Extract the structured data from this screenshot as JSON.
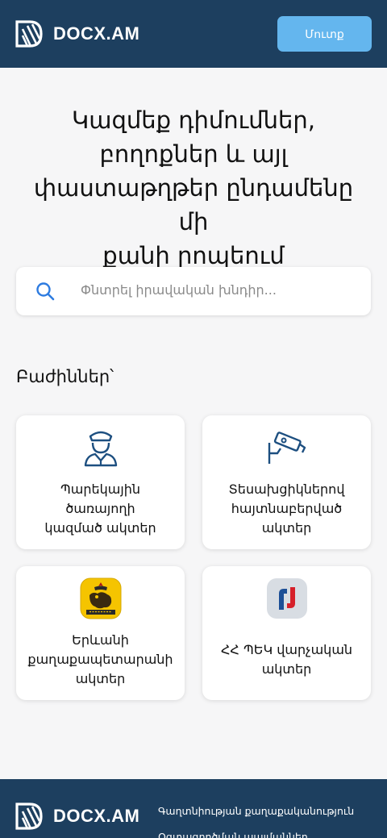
{
  "header": {
    "logo_text": "DOCX.AM",
    "login_label": "Մուտք"
  },
  "hero": {
    "title_lines": [
      "Կազմեք դիմումներ,",
      "բողոքներ և այլ",
      "փաստաթղթեր ընդամենը մի",
      "քանի րոպեում"
    ]
  },
  "search": {
    "placeholder": "Փնտրել իրավական խնդիր..."
  },
  "sections": {
    "title": "Բաժիններ՝",
    "cards": [
      {
        "icon": "officer-icon",
        "lines": [
          "Պարեկային",
          "ծառայողի",
          "կազմած ակտեր"
        ]
      },
      {
        "icon": "camera-icon",
        "lines": [
          "Տեսախցիկներով",
          "հայտնաբերված",
          "ակտեր"
        ]
      },
      {
        "icon": "yerevan-emblem-icon",
        "lines": [
          "Երևանի",
          "քաղաքապետարանի",
          "ակտեր"
        ]
      },
      {
        "icon": "src-logo-icon",
        "lines": [
          "ՀՀ ՊԵԿ վարչական",
          "ակտեր"
        ]
      }
    ]
  },
  "footer": {
    "logo_text": "DOCX.AM",
    "links": [
      "Գաղտնիության քաղաքականություն",
      "Օգտագործման պայմաններ"
    ]
  },
  "colors": {
    "header_bg": "#1d3f5f",
    "login_bg": "#64b6ee",
    "icon_blue": "#1d4f80",
    "search_icon": "#2d7be0"
  }
}
